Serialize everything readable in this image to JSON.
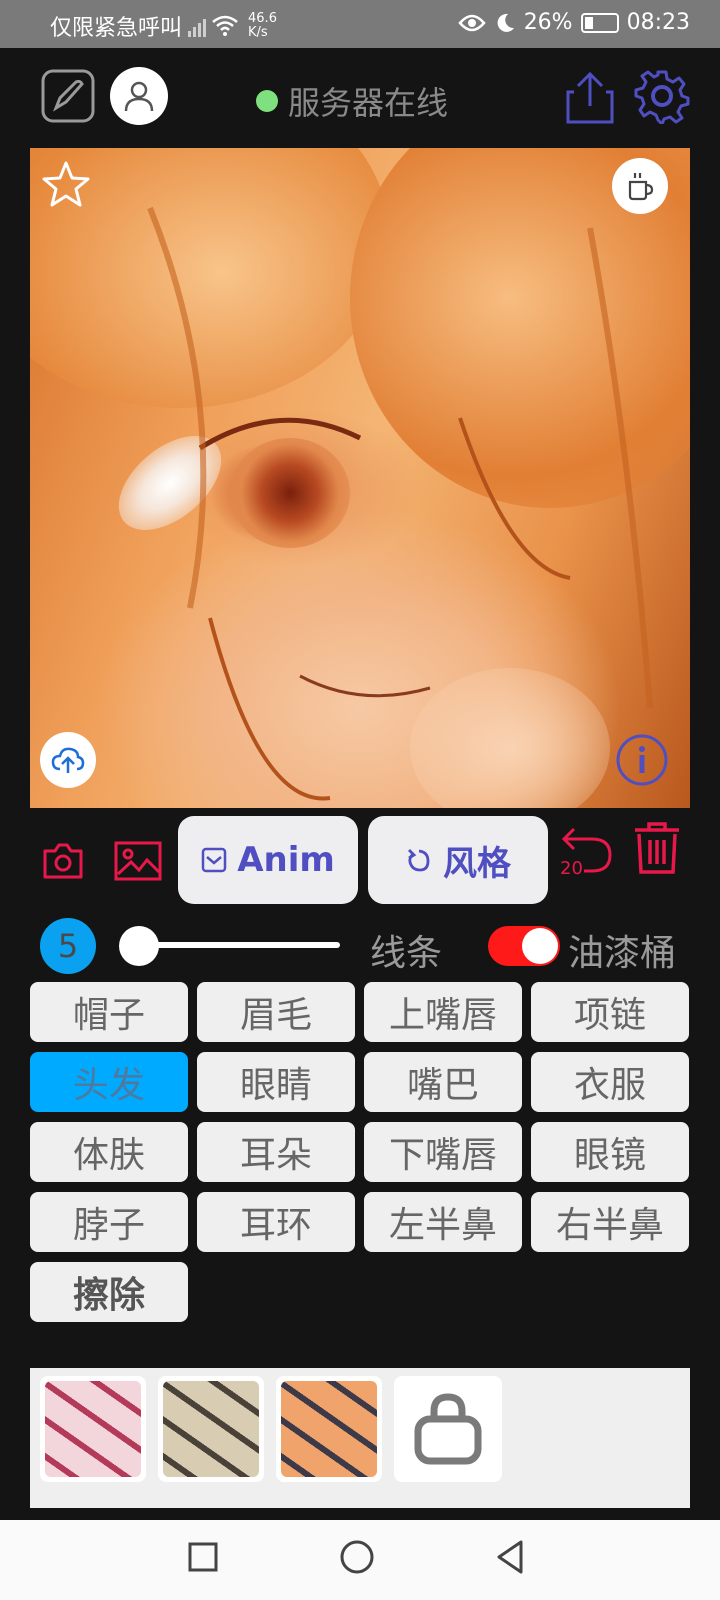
{
  "status_bar": {
    "carrier_text": "仅限紧急呼叫",
    "net_speed_value": "46.6",
    "net_speed_unit": "K/s",
    "battery": "26%",
    "time": "08:23"
  },
  "header": {
    "server_status": "服务器在线",
    "server_status_color": "#7ee07e"
  },
  "toolbar": {
    "anim_label": "Anim",
    "style_label": "风格",
    "undo_count": "20"
  },
  "brush": {
    "size": "5",
    "size_fraction": 0.05,
    "line_label": "线条",
    "fill_label": "油漆桶",
    "fill_enabled": true
  },
  "parts": [
    {
      "label": "帽子"
    },
    {
      "label": "眉毛"
    },
    {
      "label": "上嘴唇"
    },
    {
      "label": "项链"
    },
    {
      "label": "头发",
      "selected": true
    },
    {
      "label": "眼睛"
    },
    {
      "label": "嘴巴"
    },
    {
      "label": "衣服"
    },
    {
      "label": "体肤"
    },
    {
      "label": "耳朵"
    },
    {
      "label": "下嘴唇"
    },
    {
      "label": "眼镜"
    },
    {
      "label": "脖子"
    },
    {
      "label": "耳环"
    },
    {
      "label": "左半鼻"
    },
    {
      "label": "右半鼻"
    },
    {
      "label": "擦除",
      "bold": true
    }
  ],
  "style_presets": [
    {
      "name": "style-preset-red",
      "colors": [
        "#f3d6dc",
        "#b43a5a"
      ]
    },
    {
      "name": "style-preset-khaki",
      "colors": [
        "#d8ccb2",
        "#4a4238"
      ]
    },
    {
      "name": "style-preset-orange",
      "colors": [
        "#f0a36a",
        "#3c3a48"
      ]
    }
  ],
  "colors": {
    "accent_purple": "#4f4fc2",
    "accent_red": "#e8194a",
    "selected_chip": "#00aaff",
    "toggle_on": "#ff1a1a"
  }
}
